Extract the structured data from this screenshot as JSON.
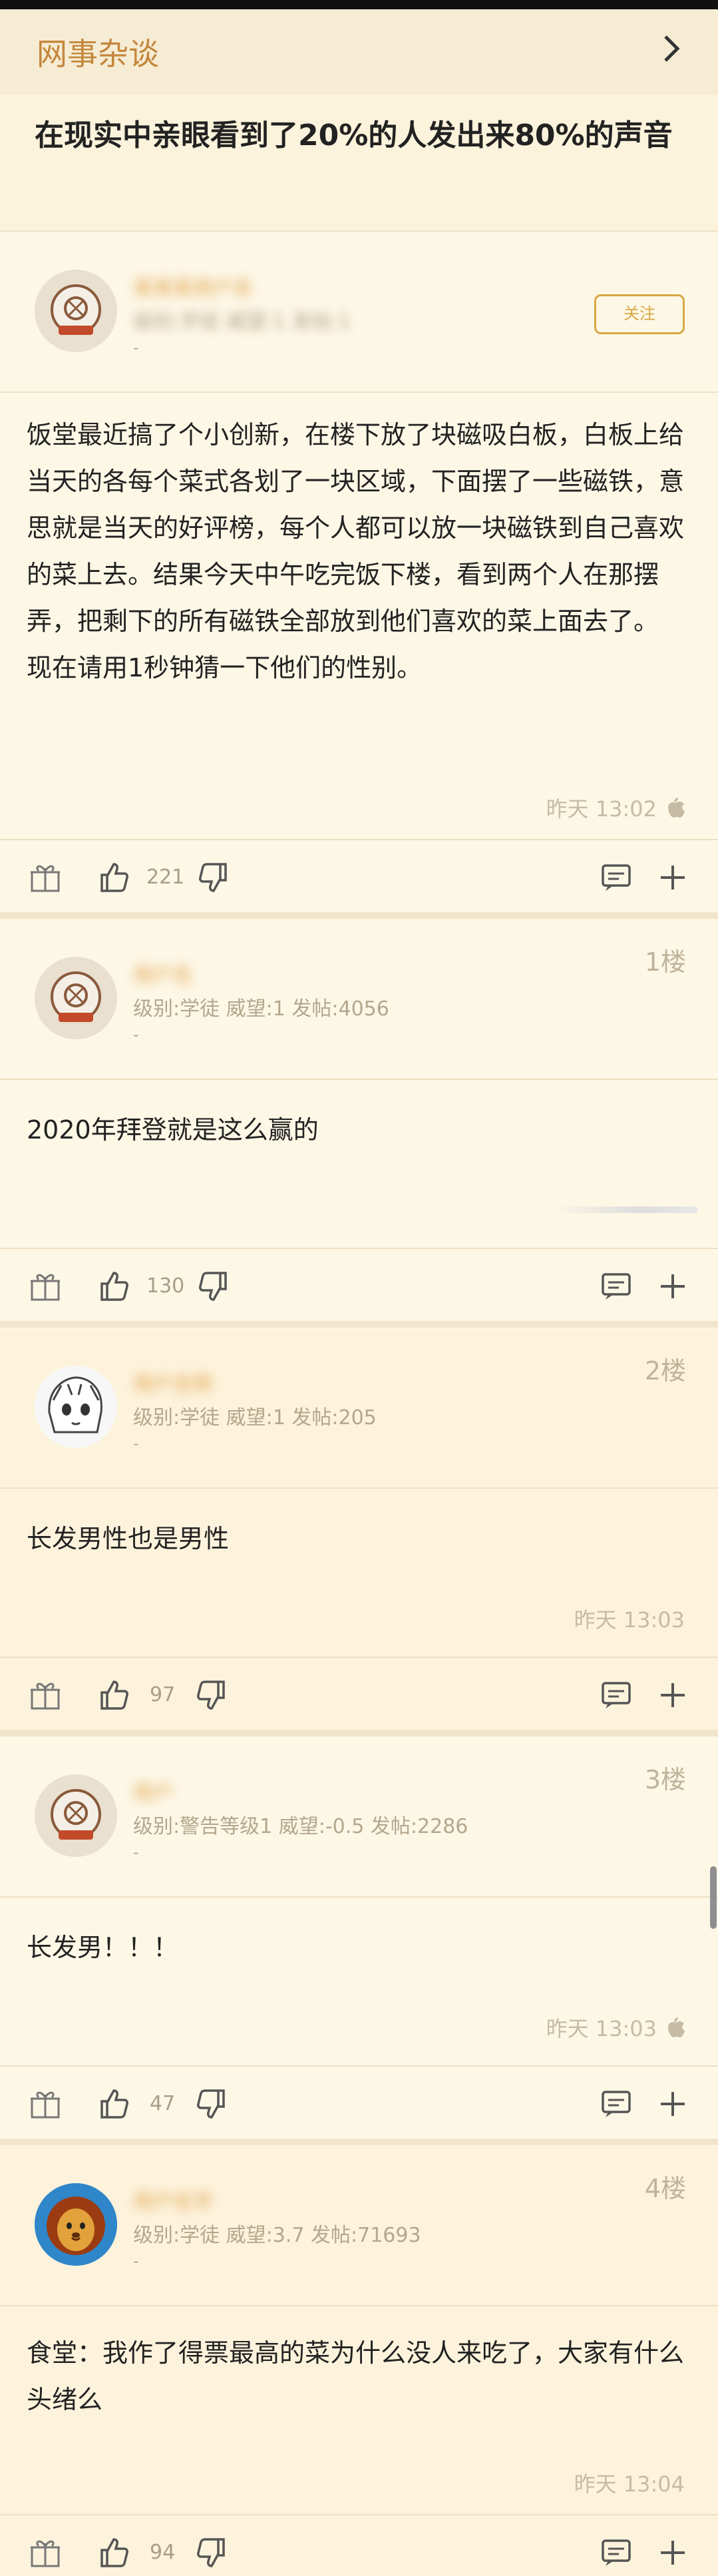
{
  "header": {
    "forum_name": "网事杂谈"
  },
  "thread": {
    "title": "在现实中亲眼看到了20%的人发出来80%的声音"
  },
  "colors": {
    "accent": "#c4873c",
    "follow": "#d8a743",
    "bg": "#fdf6e3"
  },
  "op": {
    "username": "某某某用户名",
    "meta": "级别:学徒 威望:1 发帖:1",
    "dash": "-",
    "follow_label": "关注",
    "content": "饭堂最近搞了个小创新，在楼下放了块磁吸白板，白板上给当天的各每个菜式各划了一块区域，下面摆了一些磁铁，意思就是当天的好评榜，每个人都可以放一块磁铁到自己喜欢的菜上去。结果今天中午吃完饭下楼，看到两个人在那摆弄，把剩下的所有磁铁全部放到他们喜欢的菜上面去了。\n现在请用1秒钟猜一下他们的性别。",
    "time": "昨天 13:02",
    "likes": "221"
  },
  "replies": [
    {
      "floor": "1楼",
      "username": "用户名",
      "meta": "级别:学徒 威望:1 发帖:4056",
      "dash": "-",
      "content": "2020年拜登就是这么赢的",
      "time": "",
      "likes": "130"
    },
    {
      "floor": "2楼",
      "username": "用户名称",
      "meta": "级别:学徒 威望:1 发帖:205",
      "dash": "-",
      "content": "长发男性也是男性",
      "time": "昨天 13:03",
      "likes": "97"
    },
    {
      "floor": "3楼",
      "username": "用户",
      "meta": "级别:警告等级1 威望:-0.5 发帖:2286",
      "dash": "-",
      "content": "长发男！！！",
      "time": "昨天 13:03",
      "likes": "47"
    },
    {
      "floor": "4楼",
      "username": "用户名字",
      "meta": "级别:学徒 威望:3.7 发帖:71693",
      "dash": "-",
      "content": "食堂：我作了得票最高的菜为什么没人来吃了，大家有什么头绪么",
      "time": "昨天 13:04",
      "likes": "94"
    }
  ],
  "icons": [
    "gift-icon",
    "thumbs-up-icon",
    "thumbs-down-icon",
    "comment-icon",
    "plus-icon",
    "apple-icon",
    "chevron-right-icon"
  ]
}
